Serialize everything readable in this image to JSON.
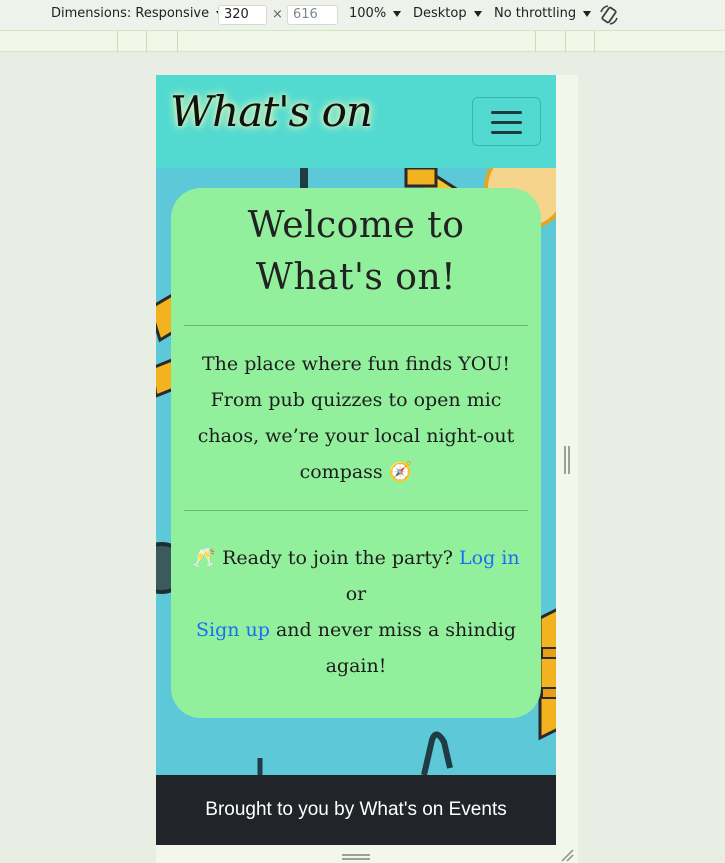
{
  "devtools": {
    "dimensions_label": "Dimensions: Responsive",
    "width_value": "320",
    "height_value": "616",
    "zoom_label": "100%",
    "device_label": "Desktop",
    "throttling_label": "No throttling",
    "x_separator": "×"
  },
  "site": {
    "brand": "What's on",
    "hero": {
      "title_line1": "Welcome to",
      "title_line2": "What's on!",
      "tagline_line1": "The place where fun finds YOU!",
      "tagline_line2": "From pub quizzes to open mic",
      "tagline_line3": "chaos, we’re your local night-out",
      "tagline_line4": "compass 🧭",
      "cta_prefix": "🥂 Ready to join the party? ",
      "login_link": "Log in",
      "cta_or": "or",
      "signup_link": "Sign up",
      "cta_suffix1": " and never miss a shindig",
      "cta_suffix2": "again!"
    },
    "footer_text": "Brought to you by What's on Events"
  },
  "colors": {
    "navbar": "#52dad1",
    "card": "#92f09d",
    "footer": "#212529",
    "link": "#1a6ef5"
  }
}
